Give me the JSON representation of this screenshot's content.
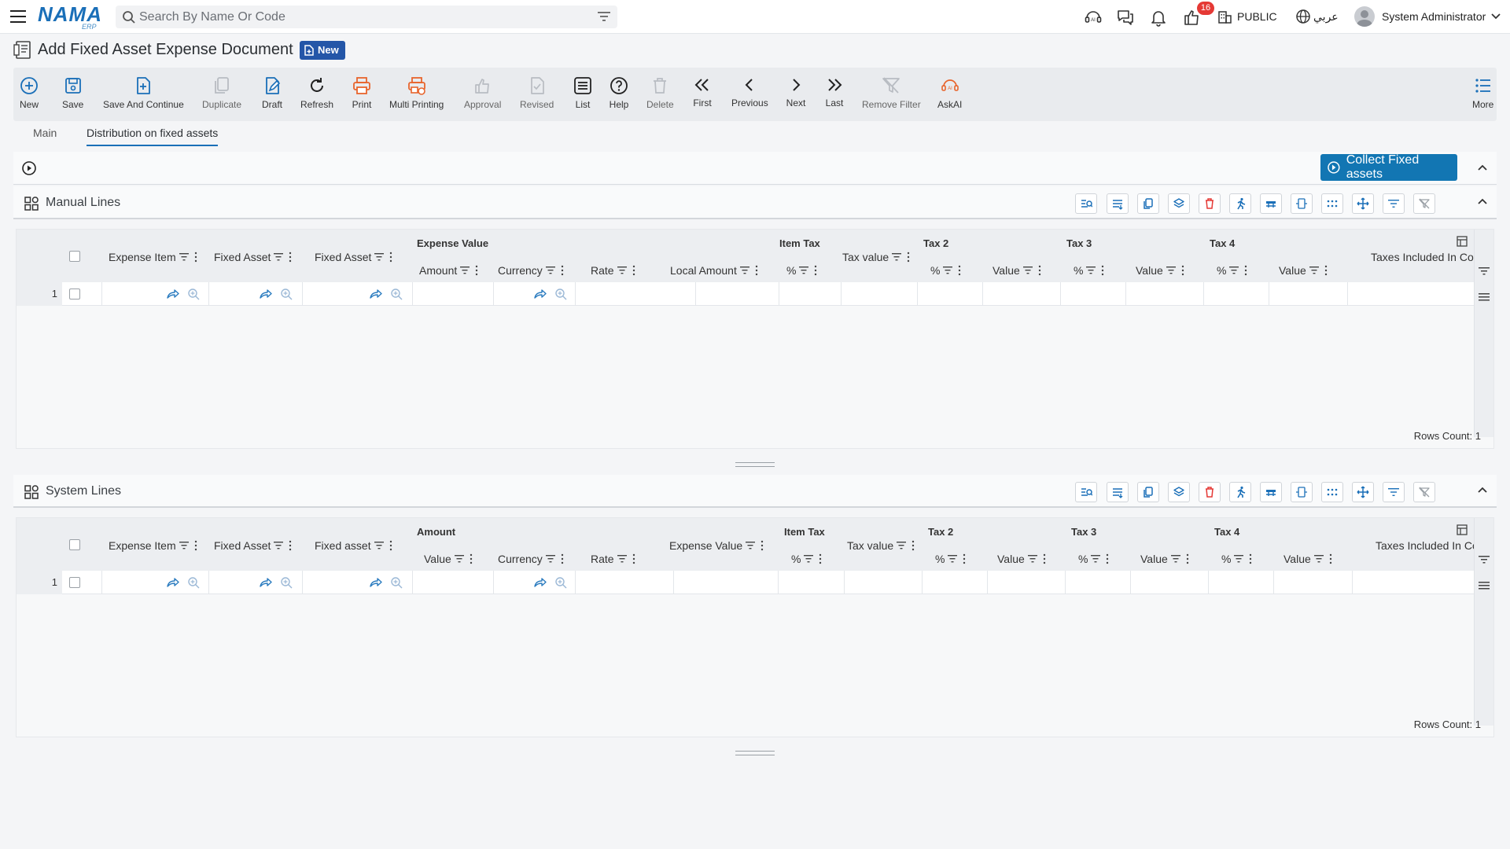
{
  "header": {
    "logo_text": "NAMA",
    "logo_sub": "ERP",
    "search_placeholder": "Search By Name Or Code",
    "notification_count": "16",
    "company": "PUBLIC",
    "language": "عربي",
    "user": "System Administrator"
  },
  "page": {
    "title": "Add Fixed Asset Expense Document",
    "status_badge": "New"
  },
  "toolbar": {
    "items": [
      {
        "label": "New",
        "icon": "plus-circle-icon",
        "enabled": true
      },
      {
        "label": "Save",
        "icon": "save-icon",
        "enabled": true
      },
      {
        "label": "Save And Continue",
        "icon": "save-continue-icon",
        "enabled": true
      },
      {
        "label": "Duplicate",
        "icon": "duplicate-icon",
        "enabled": false
      },
      {
        "label": "Draft",
        "icon": "draft-icon",
        "enabled": true
      },
      {
        "label": "Refresh",
        "icon": "refresh-icon",
        "enabled": true
      },
      {
        "label": "Print",
        "icon": "print-icon",
        "enabled": true
      },
      {
        "label": "Multi Printing",
        "icon": "multi-print-icon",
        "enabled": true
      },
      {
        "label": "Approval",
        "icon": "thumbs-up-icon",
        "enabled": false
      },
      {
        "label": "Revised",
        "icon": "revised-icon",
        "enabled": false
      },
      {
        "label": "List",
        "icon": "list-icon",
        "enabled": true
      },
      {
        "label": "Help",
        "icon": "help-icon",
        "enabled": true
      },
      {
        "label": "Delete",
        "icon": "trash-icon",
        "enabled": false
      },
      {
        "label": "First",
        "icon": "double-chevron-left-icon",
        "enabled": true
      },
      {
        "label": "Previous",
        "icon": "chevron-left-icon",
        "enabled": true
      },
      {
        "label": "Next",
        "icon": "chevron-right-icon",
        "enabled": true
      },
      {
        "label": "Last",
        "icon": "double-chevron-right-icon",
        "enabled": true
      },
      {
        "label": "Remove Filter",
        "icon": "filter-remove-icon",
        "enabled": false
      },
      {
        "label": "AskAI",
        "icon": "ai-icon",
        "enabled": true
      },
      {
        "label": "More",
        "icon": "more-list-icon",
        "enabled": true
      }
    ]
  },
  "tabs": [
    {
      "label": "Main",
      "active": false
    },
    {
      "label": "Distribution on fixed assets",
      "active": true
    }
  ],
  "actions": {
    "collect_label": "Collect Fixed assets"
  },
  "manual_lines": {
    "title": "Manual Lines",
    "group_headers": [
      "Expense Value",
      "Item Tax",
      "Tax 2",
      "Tax 3",
      "Tax 4"
    ],
    "columns": [
      "Expense Item",
      "Fixed Asset",
      "Fixed Asset",
      "Amount",
      "Currency",
      "Rate",
      "Local Amount",
      "%",
      "Tax value",
      "%",
      "Value",
      "%",
      "Value",
      "%",
      "Value",
      "Taxes Included In Cost"
    ],
    "row_number": "1",
    "rows_count": "Rows Count: 1"
  },
  "system_lines": {
    "title": "System Lines",
    "group_headers": [
      "Amount",
      "Item Tax",
      "Tax 2",
      "Tax 3",
      "Tax 4"
    ],
    "columns": [
      "Expense Item",
      "Fixed Asset",
      "Fixed asset",
      "Value",
      "Currency",
      "Rate",
      "Expense Value",
      "%",
      "Tax value",
      "%",
      "Value",
      "%",
      "Value",
      "%",
      "Value",
      "Taxes Included In Cost"
    ],
    "row_number": "1",
    "rows_count": "Rows Count: 1"
  },
  "colors": {
    "brand": "#1a6fb8",
    "accent": "#1276b3",
    "badge_new": "#2456a8",
    "notification": "#e53935",
    "print": "#e8642c",
    "delete": "#e53935"
  }
}
